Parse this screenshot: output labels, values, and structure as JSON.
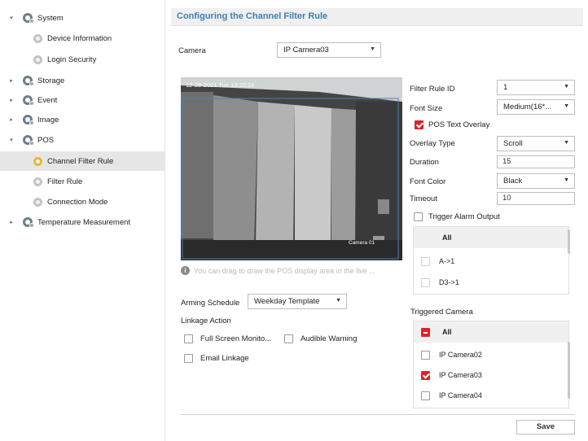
{
  "sidebar": {
    "items": [
      {
        "label": "System",
        "level": 0,
        "caret": "▾",
        "icon": "system-gear-icon"
      },
      {
        "label": "Device Information",
        "level": 1,
        "icon": "settings-icon"
      },
      {
        "label": "Login Security",
        "level": 1,
        "icon": "settings-icon"
      },
      {
        "label": "Storage",
        "level": 0,
        "caret": "▸",
        "icon": "storage-gear-icon"
      },
      {
        "label": "Event",
        "level": 0,
        "caret": "▸",
        "icon": "event-gear-icon"
      },
      {
        "label": "Image",
        "level": 0,
        "caret": "▸",
        "icon": "image-gear-icon"
      },
      {
        "label": "POS",
        "level": 0,
        "caret": "▾",
        "icon": "pos-gear-icon"
      },
      {
        "label": "Channel Filter Rule",
        "level": 1,
        "icon": "settings-icon",
        "selected": true
      },
      {
        "label": "Filter Rule",
        "level": 1,
        "icon": "settings-icon"
      },
      {
        "label": "Connection Mode",
        "level": 1,
        "icon": "settings-icon"
      },
      {
        "label": "Temperature Measurement",
        "level": 0,
        "caret": "▸",
        "icon": "temperature-gear-icon"
      }
    ]
  },
  "page": {
    "title": "Configuring the Channel Filter Rule"
  },
  "camera": {
    "label": "Camera",
    "value": "IP Camera03"
  },
  "video": {
    "timestamp": "12-28-2021 Tue 13:20:24",
    "camera_name": "Camera 01"
  },
  "hint": "You can drag to draw the POS display area in the live ...",
  "arming": {
    "label": "Arming Schedule",
    "value": "Weekday Template"
  },
  "linkage": {
    "title": "Linkage Action",
    "full_screen": "Full Screen Monito...",
    "audible": "Audible Warning",
    "email": "Email Linkage"
  },
  "settings": {
    "filter_rule_id": {
      "label": "Filter Rule ID",
      "value": "1"
    },
    "font_size": {
      "label": "Font Size",
      "value": "Medium(16*..."
    },
    "pos_overlay": {
      "label": "POS Text Overlay",
      "checked": true
    },
    "overlay_type": {
      "label": "Overlay Type",
      "value": "Scroll"
    },
    "duration": {
      "label": "Duration",
      "value": "15"
    },
    "font_color": {
      "label": "Font Color",
      "value": "Black"
    },
    "timeout": {
      "label": "Timeout",
      "value": "10"
    },
    "trigger_alarm": {
      "label": "Trigger Alarm Output",
      "checked": false
    }
  },
  "alarm_outputs": {
    "header": "All",
    "items": [
      "A->1",
      "D3->1"
    ]
  },
  "triggered_camera": {
    "title": "Triggered Camera",
    "header": "All",
    "items": [
      {
        "label": "IP Camera02",
        "checked": false
      },
      {
        "label": "IP Camera03",
        "checked": true
      },
      {
        "label": "IP Camera04",
        "checked": false
      }
    ]
  },
  "save_label": "Save",
  "colors": {
    "accent_title": "#3c7fb1",
    "checkbox_red": "#d9252b",
    "selected_row": "#e6e6e6"
  }
}
